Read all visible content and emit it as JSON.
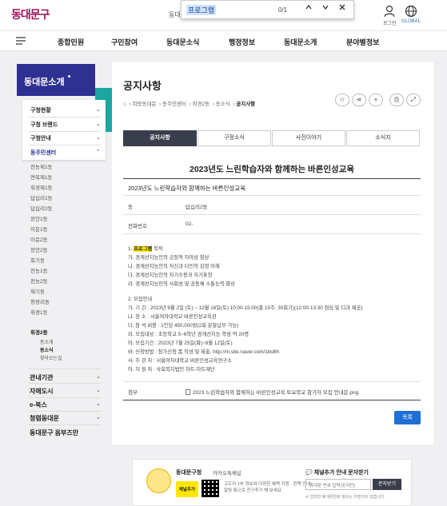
{
  "header": {
    "logo": "동대문구",
    "partial_text": "동대",
    "find": {
      "query": "프로그램",
      "count": "0/1"
    },
    "login_label": "로그인",
    "global_label": "GLOBAL"
  },
  "nav": [
    "종합민원",
    "구민참여",
    "동대문소식",
    "행정정보",
    "동대문소개",
    "분야별정보"
  ],
  "sidebar": {
    "title": "동대문소개",
    "sections": [
      "구청현황",
      "구청 브랜드",
      "구청안내",
      "동주민센터"
    ],
    "dongs": [
      "전농제1동",
      "면목제1동",
      "휘경제1동",
      "답십리1동",
      "답십리2동",
      "장안1동",
      "이문1동",
      "이문2동",
      "장안2동",
      "회기동",
      "전농1동",
      "전농2동",
      "제기동",
      "청량리동",
      "휘경1동",
      "휘경2동"
    ],
    "subitems": [
      "동소개",
      "동소식",
      "찾아오는길"
    ],
    "bottom": [
      "관내기관",
      "자매도시",
      "e-북스",
      "청렴동대문",
      "동대문구 옴부즈만"
    ]
  },
  "page": {
    "title": "공지사항",
    "breadcrumb": [
      "희망동대문",
      "동주민센터",
      "휘경2동",
      "동소식",
      "공지사항"
    ],
    "tabs": [
      "공지사항",
      "구정소식",
      "사진이야기",
      "소식지"
    ],
    "post_title": "2023년도 느린학습자와 함께하는 바른인성교육",
    "subject": "2023년도 느린학습자와 함께하는 바른인성교육",
    "dept_label": "동",
    "dept_value": "답십리2동",
    "phone_label": "전화번호",
    "phone_value": "02-",
    "body": {
      "s1_num": "1.",
      "s1_highlight": "프로그램",
      "s1_rest": "목적",
      "l1": "가. 경계선지능인의 긍정적 자아상 향상",
      "l2": "나. 경계선지능인의 자신과 타인의 감정 이해",
      "l3": "다. 경계선지능인의 자기수용과 자기표현",
      "l4": "라. 경계선지능인의 사회성 및 공동체 소통능력 향상",
      "s2": "2. 모집안내",
      "m1": "가. 기 간 : 2023년 9월 2일 (토) ~ 12월 16일(토) 10:00-15:00(총 15주, 30회기)(12:00-13:30 점심 및 디과 제공)",
      "m2": "나. 장 소 : 서울여자대학교 바른인성교육관",
      "m3": "다. 참 석 비용 : 1인당 450,000원(2회 분할납부 가능)",
      "m4": "라. 모집대상 : 초등학교 5~6학년 경계선지능 학생 약 20명",
      "m5": "마. 모집기간 : 2023년 7월 25일(화)~8월 12일(토)",
      "m6": "바. 신청방법 : 참가신청 폼 작성 및 제출, http://m.site.naver.com/1bsBh",
      "m7": "사. 주 관 처 : 서울여자대학교 바른인성교육연구소",
      "m8": "아. 지 원 처 : 사회복지법인 하트-하트재단"
    },
    "attach_label": "첨부",
    "attach_value": "2023 느린학습자와 함께하는 바른인성교육 토요학교 참가자 모집 안내문.png",
    "list_button": "목록"
  },
  "banner": {
    "title": "동대문구청",
    "subtitle": "카카오톡채널",
    "add_button": "채널추가",
    "desc1": "고도리 1부 정보와 다양한 혜택 지원 · 정책 안내",
    "desc2": "알림 톡으로 친구추가 해 보세요",
    "right_title": "채널추가 안내 문자받기",
    "phone_placeholder": "휴대폰 번호 입력(숫자만)",
    "send_button": "문자받기",
    "note": "※ 입력한 휴대폰번호 정보는 저장되지 않습니다."
  },
  "colors": {
    "brand": "#a0125a",
    "nav_box": "#2e3192",
    "accent": "#1aa7a1",
    "button": "#1e6fd6",
    "highlight": "#ffe600"
  }
}
